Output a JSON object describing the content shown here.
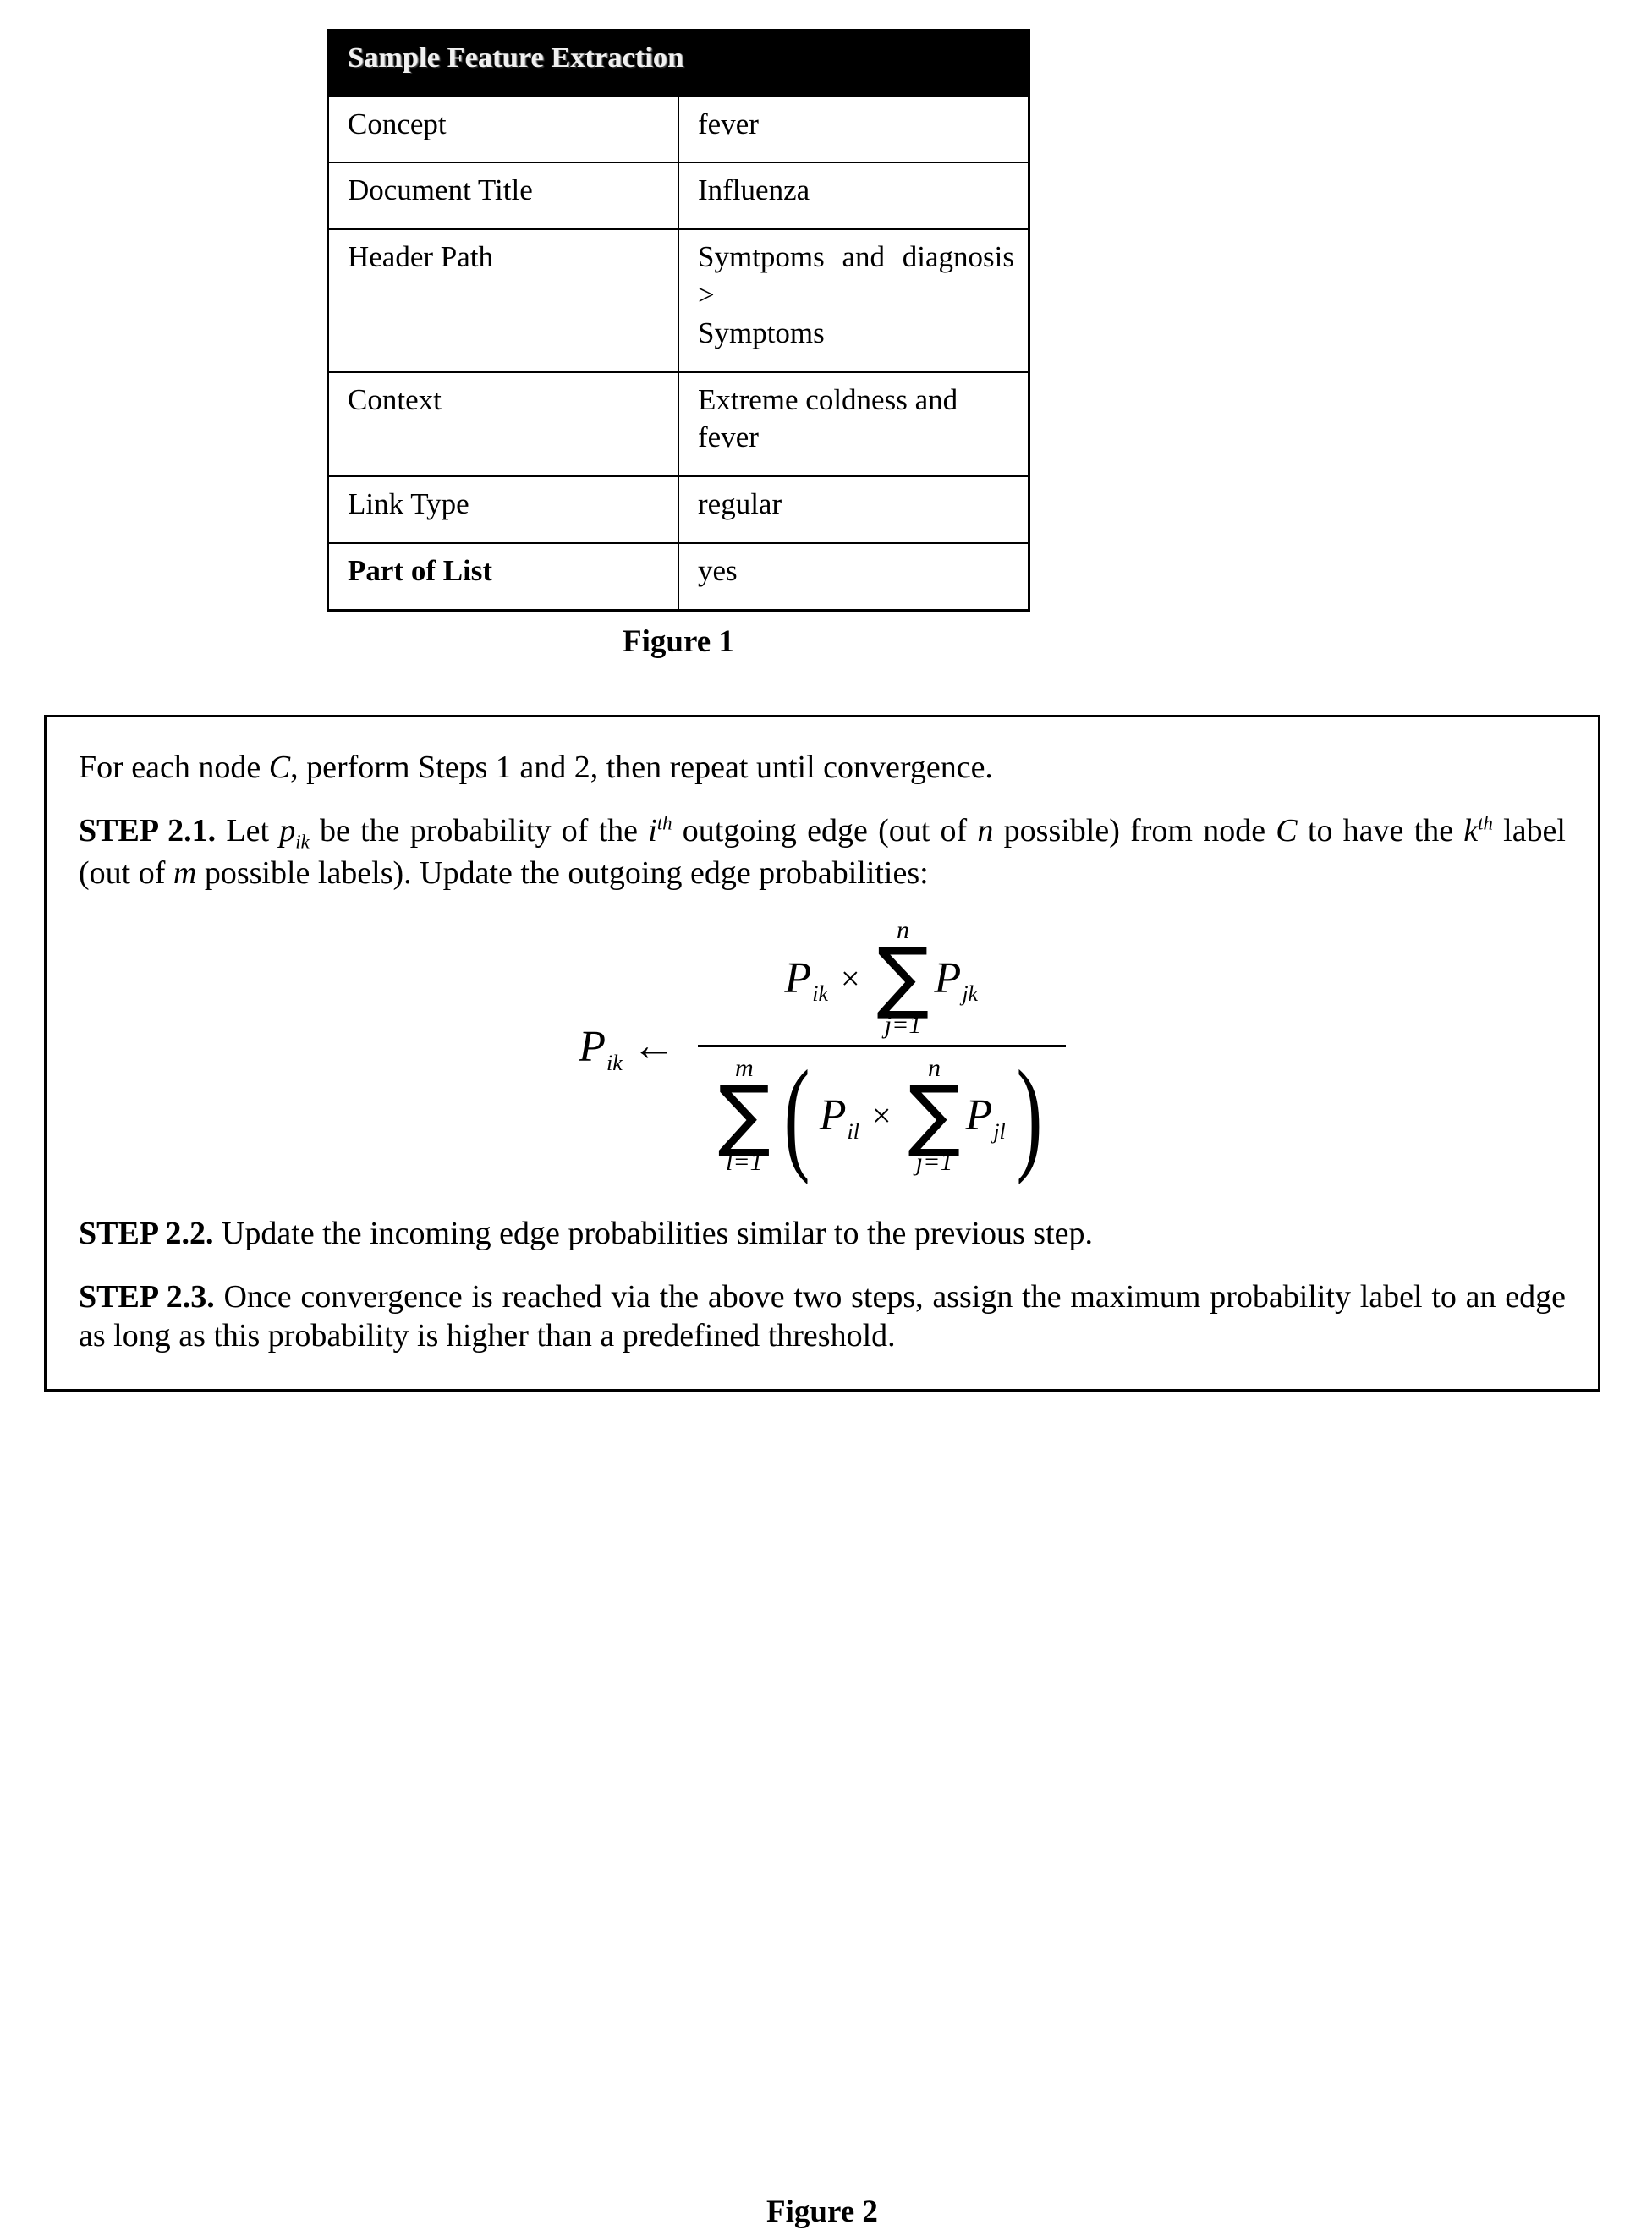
{
  "figure1": {
    "table_header": "Sample Feature Extraction",
    "rows": [
      {
        "label": "Concept",
        "value": "fever",
        "label_bold": false,
        "justify": false
      },
      {
        "label": "Document Title",
        "value": "Influenza",
        "label_bold": false,
        "justify": false
      },
      {
        "label": "Header Path",
        "value_line1": "Symtpoms and diagnosis >",
        "value_line2": "Symptoms",
        "label_bold": false,
        "justify": true
      },
      {
        "label": "Context",
        "value": "Extreme coldness and fever",
        "label_bold": false,
        "justify": false
      },
      {
        "label": "Link Type",
        "value": "regular",
        "label_bold": false,
        "justify": false
      },
      {
        "label": "Part of List",
        "value": "yes",
        "label_bold": true,
        "justify": false
      }
    ],
    "caption": "Figure 1"
  },
  "figure2": {
    "intro": {
      "before_var": "For each node ",
      "var": "C",
      "after_var": ", perform Steps 1 and 2, then repeat until convergence."
    },
    "step21": {
      "tag": "STEP 2.1.",
      "t1": " Let ",
      "p_sym": "p",
      "p_sub": "ik",
      "t2": " be the probability of the ",
      "i_sym": "i",
      "i_sup": "th",
      "t3": " outgoing edge (out of ",
      "n_sym": "n",
      "t4": " possible) from node ",
      "c_sym": "C",
      "t5": " to have the ",
      "k_sym": "k",
      "k_sup": "th",
      "t6": " label (out of ",
      "m_sym": "m",
      "t7": " possible labels). Update the outgoing edge probabilities:"
    },
    "equation": {
      "lhs_sym": "P",
      "lhs_sub": "ik",
      "arrow": "←",
      "numerator": {
        "first_sym": "P",
        "first_sub": "ik",
        "times": "×",
        "sum_top": "n",
        "sum_sym": "∑",
        "sum_bottom": "j=1",
        "second_sym": "P",
        "second_sub": "jk"
      },
      "denominator": {
        "outer_sum_top": "m",
        "outer_sum_sym": "∑",
        "outer_sum_bottom": "l=1",
        "paren_open": "(",
        "paren_close": ")",
        "first_sym": "P",
        "first_sub": "il",
        "times": "×",
        "inner_sum_top": "n",
        "inner_sum_sym": "∑",
        "inner_sum_bottom": "j=1",
        "second_sym": "P",
        "second_sub": "jl"
      }
    },
    "step22": {
      "tag": "STEP 2.2.",
      "text": "  Update the incoming edge probabilities similar to the previous step."
    },
    "step23": {
      "tag": "STEP 2.3.",
      "text": "   Once convergence is reached via the above two steps, assign the maximum probability label to an edge as long as this probability is higher than a predefined threshold."
    },
    "caption": "Figure 2"
  }
}
